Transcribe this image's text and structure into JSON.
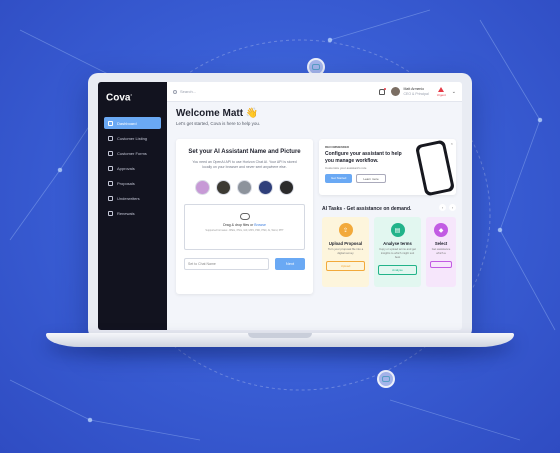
{
  "brand": {
    "name": "Cova",
    "accent": "#6aa9f4",
    "sidebar_bg": "#12131f"
  },
  "sidebar": {
    "items": [
      {
        "label": "Dashboard",
        "icon": "home-icon",
        "active": true
      },
      {
        "label": "Customer Listing",
        "icon": "users-icon",
        "active": false
      },
      {
        "label": "Customer Forms",
        "icon": "form-icon",
        "active": false
      },
      {
        "label": "Approvals",
        "icon": "check-icon",
        "active": false
      },
      {
        "label": "Proposals",
        "icon": "document-icon",
        "active": false
      },
      {
        "label": "Underwriters",
        "icon": "briefcase-icon",
        "active": false
      },
      {
        "label": "Renewals",
        "icon": "refresh-icon",
        "active": false
      }
    ]
  },
  "topbar": {
    "search_placeholder": "Search...",
    "user_name": "Matt Armenio",
    "user_role": "CEO & Principal",
    "alert_label": "Urgent"
  },
  "welcome": {
    "title": "Welcome Matt 👋",
    "subtitle": "Let's get started, Cova is here to help you."
  },
  "setup": {
    "title": "Set your AI Assistant Name and Picture",
    "description": "You need an OpenAI API to use Horizon Chat AI. Your API is stored locally on your browser and never sent anywhere else.",
    "dropzone_text": "Drag & drop files or",
    "dropzone_link": "Browse",
    "dropzone_formats": "Supported formates: JPEG, PNG, GIF, MP4, PDF, PSD, AI, Word, PPT",
    "name_placeholder": "Set to Chat Name",
    "next_label": "Next"
  },
  "recommended": {
    "tag": "RECOMMENDED",
    "title": "Configure your assistant to help you manage workflow.",
    "subtitle": "Customize your assistant's role",
    "primary_label": "Get Started",
    "secondary_label": "Learn more"
  },
  "tasks": {
    "heading": "AI Tasks - Get assistance on demand.",
    "cards": [
      {
        "title": "Upload Proposal",
        "description": "Turn your proposal file into a digital survey",
        "button": "Upload",
        "bg": "#fdf5dc",
        "color": "#f2a93b"
      },
      {
        "title": "Analyse terms",
        "description": "Copy or upload terms and get insights to which might suit best",
        "button": "Analyse",
        "bg": "#e2f7f0",
        "color": "#22b38a"
      },
      {
        "title": "Select",
        "description": "Get assistance which a",
        "button": "",
        "bg": "#f6e6fb",
        "color": "#c25be3"
      }
    ]
  }
}
